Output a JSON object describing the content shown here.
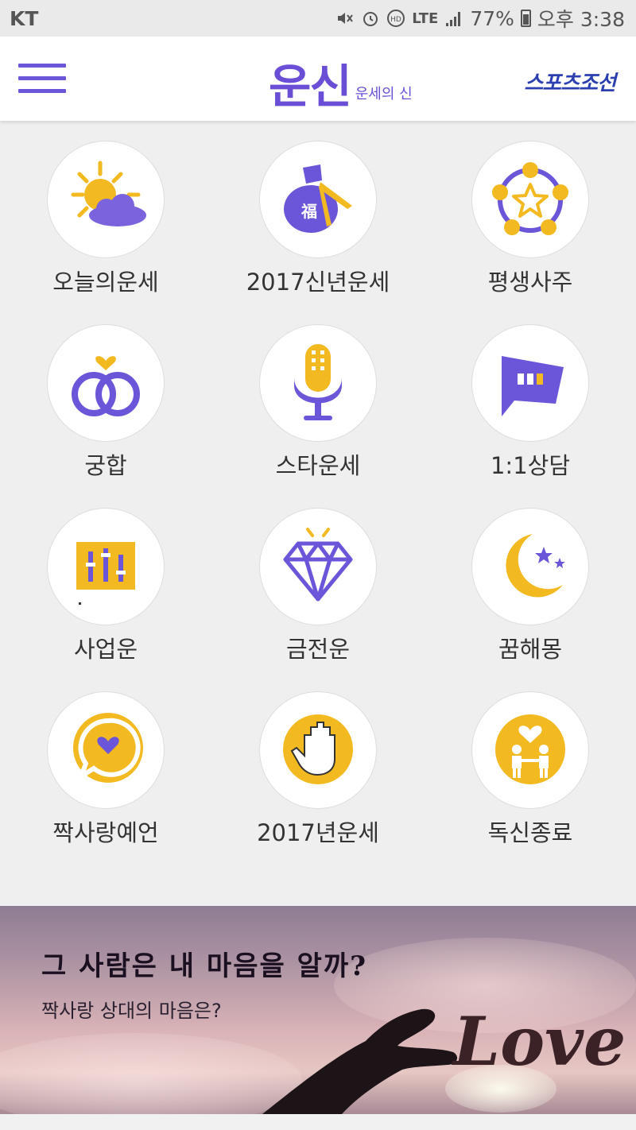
{
  "status_bar": {
    "carrier": "KT",
    "network": "LTE",
    "battery": "77%",
    "time": "오후 3:38"
  },
  "header": {
    "logo_main": "운신",
    "logo_sub": "운세의 신",
    "partner": "스포츠조선"
  },
  "menu": [
    {
      "label": "오늘의운세",
      "icon": "sun-cloud-icon"
    },
    {
      "label": "2017신년운세",
      "icon": "lucky-bag-icon"
    },
    {
      "label": "평생사주",
      "icon": "star-orbit-icon"
    },
    {
      "label": "궁합",
      "icon": "rings-heart-icon"
    },
    {
      "label": "스타운세",
      "icon": "microphone-icon"
    },
    {
      "label": "1:1상담",
      "icon": "chat-bubble-icon"
    },
    {
      "label": "사업운",
      "icon": "business-chart-icon"
    },
    {
      "label": "금전운",
      "icon": "diamond-icon"
    },
    {
      "label": "꿈해몽",
      "icon": "moon-stars-icon"
    },
    {
      "label": "짝사랑예언",
      "icon": "heart-speech-icon"
    },
    {
      "label": "2017년운세",
      "icon": "palm-hand-icon"
    },
    {
      "label": "독신종료",
      "icon": "couple-heart-icon"
    }
  ],
  "banner": {
    "title": "그 사람은 내 마음을 알까?",
    "subtitle": "짝사랑 상대의 마음은?",
    "art_text": "Love"
  },
  "colors": {
    "accent_purple": "#6b55d8",
    "accent_yellow": "#f2b920",
    "partner_blue": "#2b3fb0"
  }
}
